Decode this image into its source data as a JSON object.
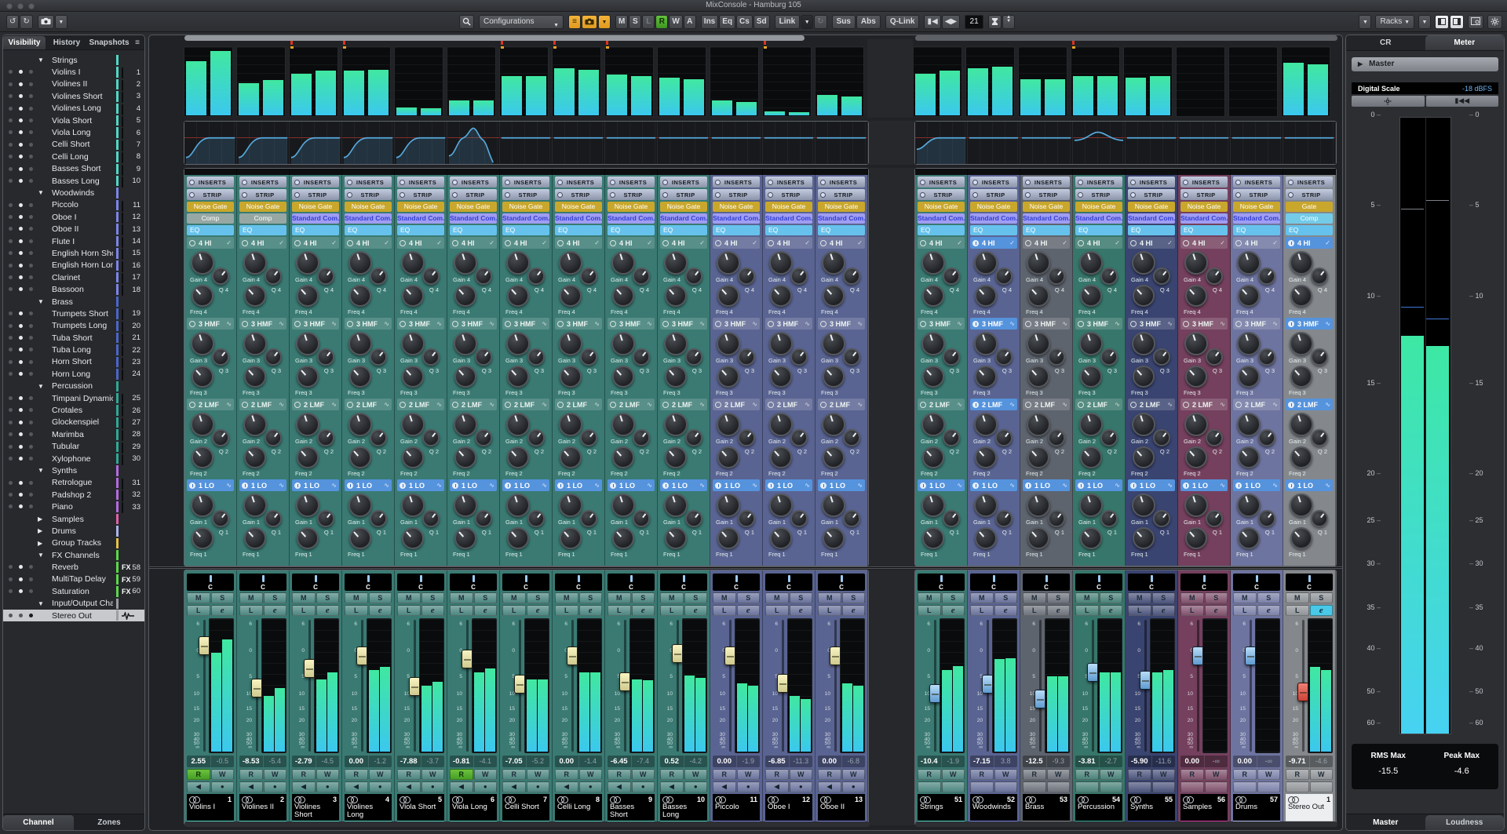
{
  "window": {
    "title": "MixConsole - Hamburg 105"
  },
  "toolbar": {
    "undo": "↺",
    "redo": "↻",
    "configurations": "Configurations",
    "channel_buttons": [
      "M",
      "S",
      "L",
      "R",
      "W",
      "A"
    ],
    "active_channel_button": "R",
    "disabled_channel_button": "L",
    "rack_filter_buttons": [
      "Ins",
      "Eq",
      "Cs",
      "Sd"
    ],
    "link": "Link",
    "sus": "Sus",
    "abs": "Abs",
    "qlink": "Q-Link",
    "width_value": "21",
    "racks": "Racks"
  },
  "sidebar": {
    "tabs": [
      "Visibility",
      "History",
      "Snapshots"
    ],
    "active_tab": "Visibility",
    "menu_icon": "≡",
    "bottom_tabs": [
      "Channel",
      "Zones"
    ],
    "active_bottom_tab": "Channel",
    "groups": [
      {
        "label": "Strings",
        "color": "#52d7c7",
        "collapsed": false,
        "items": [
          {
            "num": "1",
            "name": "Violins I"
          },
          {
            "num": "2",
            "name": "Violines II"
          },
          {
            "num": "3",
            "name": "Violines Short"
          },
          {
            "num": "4",
            "name": "Violines Long"
          },
          {
            "num": "5",
            "name": "Viola Short"
          },
          {
            "num": "6",
            "name": "Viola Long"
          },
          {
            "num": "7",
            "name": "Celli Short"
          },
          {
            "num": "8",
            "name": "Celli Long"
          },
          {
            "num": "9",
            "name": "Basses Short"
          },
          {
            "num": "10",
            "name": "Basses Long"
          }
        ]
      },
      {
        "label": "Woodwinds",
        "color": "#7b85e8",
        "collapsed": false,
        "items": [
          {
            "num": "11",
            "name": "Piccolo"
          },
          {
            "num": "12",
            "name": "Oboe I"
          },
          {
            "num": "13",
            "name": "Oboe II"
          },
          {
            "num": "14",
            "name": "Flute I"
          },
          {
            "num": "15",
            "name": "English Horn Short"
          },
          {
            "num": "16",
            "name": "English Horn Long"
          },
          {
            "num": "17",
            "name": "Clarinet"
          },
          {
            "num": "18",
            "name": "Bassoon"
          }
        ]
      },
      {
        "label": "Brass",
        "color": "#4a66c8",
        "collapsed": false,
        "items": [
          {
            "num": "19",
            "name": "Trumpets Short"
          },
          {
            "num": "20",
            "name": "Trumpets Long"
          },
          {
            "num": "21",
            "name": "Tuba Short"
          },
          {
            "num": "22",
            "name": "Tuba Long"
          },
          {
            "num": "23",
            "name": "Horn Short"
          },
          {
            "num": "24",
            "name": "Horn Long"
          }
        ]
      },
      {
        "label": "Percussion",
        "color": "#2fa896",
        "collapsed": false,
        "items": [
          {
            "num": "25",
            "name": "Timpani Dynamics"
          },
          {
            "num": "26",
            "name": "Crotales"
          },
          {
            "num": "27",
            "name": "Glockenspiel"
          },
          {
            "num": "28",
            "name": "Marimba"
          },
          {
            "num": "29",
            "name": "Tubular"
          },
          {
            "num": "30",
            "name": "Xylophone"
          }
        ]
      },
      {
        "label": "Synths",
        "color": "#b56ae0",
        "collapsed": false,
        "items": [
          {
            "num": "31",
            "name": "Retrologue"
          },
          {
            "num": "32",
            "name": "Padshop 2"
          },
          {
            "num": "33",
            "name": "Piano"
          }
        ]
      },
      {
        "label": "Samples",
        "color": "#e060a8",
        "collapsed": true,
        "items": []
      },
      {
        "label": "Drums",
        "color": "#aab4ea",
        "collapsed": true,
        "items": []
      },
      {
        "label": "Group Tracks",
        "color": "#e8c048",
        "collapsed": true,
        "items": []
      },
      {
        "label": "FX Channels",
        "color": "#5ad848",
        "collapsed": false,
        "items": [
          {
            "num": "58",
            "name": "Reverb",
            "badge": "FX"
          },
          {
            "num": "59",
            "name": "MultiTap Delay",
            "badge": "FX"
          },
          {
            "num": "60",
            "name": "Saturation",
            "badge": "FX"
          }
        ]
      },
      {
        "label": "Input/Output Channels",
        "color": "#9a9da2",
        "collapsed": false,
        "items": [
          {
            "num": "",
            "name": "Stereo Out",
            "badge": "wave",
            "selected": true
          }
        ]
      }
    ]
  },
  "rack": {
    "inserts": "INSERTS",
    "strip": "STRIP",
    "bands": [
      {
        "id": "4 HI",
        "gain": "Gain 4",
        "freq": "Freq 4",
        "q": "Q 4",
        "icon": "✓"
      },
      {
        "id": "3 HMF",
        "gain": "Gain 3",
        "freq": "Freq 3",
        "q": "Q 3",
        "icon": "∿"
      },
      {
        "id": "2 LMF",
        "gain": "Gain 2",
        "freq": "Freq 2",
        "q": "Q 2",
        "icon": "∿"
      },
      {
        "id": "1 LO",
        "gain": "Gain 1",
        "freq": "Freq 1",
        "q": "Q 1",
        "icon": "∿"
      }
    ]
  },
  "strip_labels": {
    "m": "M",
    "s": "S",
    "l": "L",
    "e": "e",
    "r": "R",
    "w": "W",
    "pan": "C",
    "mon": "◀",
    "rec": "●"
  },
  "fader_scale": [
    "6",
    "0",
    "5",
    "10",
    "15",
    "20",
    "30",
    "40",
    "50",
    "∞"
  ],
  "channels": {
    "left": [
      {
        "num": "1",
        "name": "Violins I",
        "value": "2.55",
        "peak": "-0.5",
        "db": 2.55,
        "color": "#52d7c7",
        "tint": "#3A7A73",
        "gate": "Noise Gate",
        "comp": "Comp",
        "comp_style": "cgray",
        "active_bands": [
          "1 LO"
        ],
        "eq": "rise",
        "bridge": [
          0.8,
          0.95
        ],
        "meter": [
          0.75,
          0.85
        ],
        "clip": false,
        "r_on": true,
        "cap": "yellow",
        "group": false
      },
      {
        "num": "2",
        "name": "Violines II",
        "value": "-8.53",
        "peak": "-5.4",
        "db": -8.53,
        "color": "#52d7c7",
        "tint": "#3A7A73",
        "gate": "Noise Gate",
        "comp": "Comp",
        "comp_style": "cgray",
        "active_bands": [
          "1 LO"
        ],
        "eq": "rise",
        "bridge": [
          0.48,
          0.52
        ],
        "meter": [
          0.42,
          0.48
        ],
        "clip": false,
        "r_on": false,
        "cap": "yellow",
        "group": false
      },
      {
        "num": "3",
        "name": "Violines Short",
        "value": "-2.79",
        "peak": "-4.5",
        "db": -2.79,
        "color": "#52d7c7",
        "tint": "#3A7A73",
        "gate": "Noise Gate",
        "comp": "Standard Com...or",
        "comp_style": "cpurple",
        "active_bands": [
          "1 LO"
        ],
        "eq": "rise",
        "bridge": [
          0.62,
          0.66
        ],
        "meter": [
          0.55,
          0.6
        ],
        "clip": true,
        "r_on": false,
        "cap": "yellow",
        "group": false
      },
      {
        "num": "4",
        "name": "Violines Long",
        "value": "0.00",
        "peak": "-1.2",
        "db": 0.0,
        "color": "#52d7c7",
        "tint": "#3A7A73",
        "gate": "Noise Gate",
        "comp": "Standard Com...or",
        "comp_style": "cpurple",
        "active_bands": [
          "1 LO"
        ],
        "eq": "rise",
        "bridge": [
          0.66,
          0.68
        ],
        "meter": [
          0.62,
          0.64
        ],
        "clip": true,
        "r_on": false,
        "cap": "yellow",
        "group": false
      },
      {
        "num": "5",
        "name": "Viola Short",
        "value": "-7.88",
        "peak": "-3.7",
        "db": -7.88,
        "color": "#52d7c7",
        "tint": "#3A7A73",
        "gate": "Noise Gate",
        "comp": "Standard Com...or",
        "comp_style": "cpurple",
        "active_bands": [
          "1 LO"
        ],
        "eq": "rise",
        "bridge": [
          0.12,
          0.1
        ],
        "meter": [
          0.5,
          0.53
        ],
        "clip": false,
        "r_on": false,
        "cap": "yellow",
        "group": false
      },
      {
        "num": "6",
        "name": "Viola Long",
        "value": "-0.81",
        "peak": "-4.1",
        "db": -0.81,
        "color": "#52d7c7",
        "tint": "#3A7A73",
        "gate": "Noise Gate",
        "comp": "Standard Com...or",
        "comp_style": "cpurple",
        "active_bands": [
          "1 LO"
        ],
        "eq": "peakcut",
        "bridge": [
          0.22,
          0.22
        ],
        "meter": [
          0.6,
          0.63
        ],
        "clip": false,
        "r_on": true,
        "cap": "yellow",
        "group": false
      },
      {
        "num": "7",
        "name": "Celli Short",
        "value": "-7.05",
        "peak": "-5.2",
        "db": -7.05,
        "color": "#52d7c7",
        "tint": "#3A7A73",
        "gate": "Noise Gate",
        "comp": "Standard Com...or",
        "comp_style": "cpurple",
        "active_bands": [
          "1 LO"
        ],
        "eq": "flat",
        "bridge": [
          0.58,
          0.58
        ],
        "meter": [
          0.55,
          0.55
        ],
        "clip": true,
        "r_on": false,
        "cap": "yellow",
        "group": false
      },
      {
        "num": "8",
        "name": "Celli Long",
        "value": "0.00",
        "peak": "-1.4",
        "db": 0.0,
        "color": "#52d7c7",
        "tint": "#3A7A73",
        "gate": "Noise Gate",
        "comp": "Standard Com...or",
        "comp_style": "cpurple",
        "active_bands": [
          "1 LO"
        ],
        "eq": "flat",
        "bridge": [
          0.7,
          0.68
        ],
        "meter": [
          0.6,
          0.6
        ],
        "clip": true,
        "r_on": false,
        "cap": "yellow",
        "group": false
      },
      {
        "num": "9",
        "name": "Basses Short",
        "value": "-6.45",
        "peak": "-7.4",
        "db": -6.45,
        "color": "#52d7c7",
        "tint": "#3A7A73",
        "gate": "Noise Gate",
        "comp": "Standard Com...or",
        "comp_style": "cpurple",
        "active_bands": [
          "1 LO"
        ],
        "eq": "flat",
        "bridge": [
          0.6,
          0.58
        ],
        "meter": [
          0.55,
          0.54
        ],
        "clip": true,
        "r_on": false,
        "cap": "yellow",
        "group": false
      },
      {
        "num": "10",
        "name": "Basses Long",
        "value": "0.52",
        "peak": "-4.2",
        "db": 0.52,
        "color": "#52d7c7",
        "tint": "#3A7A73",
        "gate": "Noise Gate",
        "comp": "Standard Com...or",
        "comp_style": "cpurple",
        "active_bands": [
          "1 LO"
        ],
        "eq": "flat",
        "bridge": [
          0.56,
          0.54
        ],
        "meter": [
          0.58,
          0.56
        ],
        "clip": false,
        "r_on": false,
        "cap": "yellow",
        "group": false
      },
      {
        "num": "11",
        "name": "Piccolo",
        "value": "0.00",
        "peak": "-1.9",
        "db": 0.0,
        "color": "#7b85e8",
        "tint": "#5A6492",
        "gate": "Noise Gate",
        "comp": "Standard Com...or",
        "comp_style": "cpurple",
        "active_bands": [
          "1 LO"
        ],
        "eq": "flat",
        "bridge": [
          0.22,
          0.2
        ],
        "meter": [
          0.52,
          0.5
        ],
        "clip": false,
        "r_on": false,
        "cap": "yellow",
        "group": false
      },
      {
        "num": "12",
        "name": "Oboe I",
        "value": "-6.85",
        "peak": "-11.3",
        "db": -6.85,
        "color": "#7b85e8",
        "tint": "#5A6492",
        "gate": "Noise Gate",
        "comp": "Standard Com...or",
        "comp_style": "cpurple",
        "active_bands": [
          "1 LO"
        ],
        "eq": "flat",
        "bridge": [
          0.06,
          0.05
        ],
        "meter": [
          0.42,
          0.4
        ],
        "clip": true,
        "r_on": false,
        "cap": "yellow",
        "group": false
      },
      {
        "num": "13",
        "name": "Oboe II",
        "value": "0.00",
        "peak": "-6.8",
        "db": 0.0,
        "color": "#7b85e8",
        "tint": "#5A6492",
        "gate": "Noise Gate",
        "comp": "Standard Com...or",
        "comp_style": "cpurple",
        "active_bands": [
          "1 LO"
        ],
        "eq": "flat",
        "bridge": [
          0.3,
          0.28
        ],
        "meter": [
          0.52,
          0.5
        ],
        "clip": false,
        "r_on": false,
        "cap": "yellow",
        "group": false
      }
    ],
    "right": [
      {
        "num": "51",
        "name": "Strings",
        "value": "-10.4",
        "peak": "-1.9",
        "db": -10.4,
        "color": "#52d7c7",
        "tint": "#3A7A73",
        "gate": "Noise Gate",
        "comp": "Standard Com...or",
        "comp_style": "cpurple",
        "active_bands": [
          "1 LO"
        ],
        "eq": "risesm",
        "bridge": [
          0.62,
          0.66
        ],
        "meter": [
          0.62,
          0.65
        ],
        "clip": false,
        "r_on": false,
        "cap": "blue",
        "group": true
      },
      {
        "num": "52",
        "name": "Woodwinds",
        "value": "-7.15",
        "peak": "3.8",
        "db": -7.15,
        "color": "#7b85e8",
        "tint": "#5A6492",
        "gate": "Noise Gate",
        "comp": "Standard Com...or",
        "comp_style": "cpurple",
        "active_bands": [
          "4 HI",
          "3 HMF",
          "2 LMF",
          "1 LO"
        ],
        "eq": "flat",
        "bridge": [
          0.7,
          0.72
        ],
        "meter": [
          0.7,
          0.71
        ],
        "clip": false,
        "r_on": false,
        "cap": "blue",
        "group": true
      },
      {
        "num": "53",
        "name": "Brass",
        "value": "-12.5",
        "peak": "-9.3",
        "db": -12.5,
        "color": "#8a8d92",
        "tint": "#5E646E",
        "gate": "Noise Gate",
        "comp": "Standard Com...or",
        "comp_style": "cpurple",
        "active_bands": [
          "1 LO"
        ],
        "eq": "flat",
        "bridge": [
          0.54,
          0.54
        ],
        "meter": [
          0.57,
          0.57
        ],
        "clip": false,
        "r_on": false,
        "cap": "blue",
        "group": true
      },
      {
        "num": "54",
        "name": "Percussion",
        "value": "-3.81",
        "peak": "-2.7",
        "db": -3.81,
        "color": "#2fa896",
        "tint": "#37766B",
        "gate": "Noise Gate",
        "comp": "Standard Com...or",
        "comp_style": "cpurple",
        "active_bands": [
          "1 LO"
        ],
        "eq": "bump",
        "bridge": [
          0.58,
          0.58
        ],
        "meter": [
          0.6,
          0.6
        ],
        "clip": true,
        "r_on": false,
        "cap": "blue",
        "group": true
      },
      {
        "num": "55",
        "name": "Synths",
        "value": "-5.90",
        "peak": "-11.6",
        "db": -5.9,
        "color": "#4858c8",
        "tint": "#3A4470",
        "gate": "Noise Gate",
        "comp": "Standard Com...or",
        "comp_style": "cpurple",
        "active_bands": [
          "1 LO"
        ],
        "eq": "flat",
        "bridge": [
          0.56,
          0.58
        ],
        "meter": [
          0.6,
          0.62
        ],
        "clip": false,
        "r_on": false,
        "cap": "blue",
        "group": true
      },
      {
        "num": "56",
        "name": "Samples",
        "value": "0.00",
        "peak": "-∞",
        "db": 0.0,
        "color": "#d838a0",
        "tint": "#74405E",
        "gate": "Noise Gate",
        "comp": "Standard Com...or",
        "comp_style": "cpurple",
        "active_bands": [
          "1 LO"
        ],
        "eq": "flat",
        "bridge": [
          0,
          0
        ],
        "meter": [
          0,
          0
        ],
        "clip": false,
        "r_on": false,
        "cap": "blue",
        "group": true
      },
      {
        "num": "57",
        "name": "Drums",
        "value": "0.00",
        "peak": "-∞",
        "db": 0.0,
        "color": "#b8c0f0",
        "tint": "#6E74A0",
        "gate": "Noise Gate",
        "comp": "Standard Com...or",
        "comp_style": "cpurple",
        "active_bands": [
          "1 LO"
        ],
        "eq": "flat",
        "bridge": [
          0,
          0
        ],
        "meter": [
          0,
          0
        ],
        "clip": false,
        "r_on": false,
        "cap": "blue",
        "group": true
      },
      {
        "num": "1",
        "name": "Stereo Out",
        "value": "-9.71",
        "peak": "-4.6",
        "db": -9.71,
        "color": "#c4c8cc",
        "tint": "#84888C",
        "gate": "Gate",
        "comp": "Comp",
        "comp_style": "ccyan",
        "active_bands": [
          "4 HI",
          "3 HMF",
          "2 LMF",
          "1 LO"
        ],
        "eq": "flat",
        "bridge": [
          0.78,
          0.76
        ],
        "meter": [
          0.64,
          0.62
        ],
        "clip": false,
        "r_on": false,
        "cap": "red",
        "group": true,
        "e_on": true,
        "selected": true
      }
    ]
  },
  "right_panel": {
    "tabs": [
      "CR",
      "Meter"
    ],
    "active_tab": "Meter",
    "master_select": "Master",
    "digital_scale_label": "Digital Scale",
    "digital_scale_value": "-18 dBFS",
    "meter_scale": [
      "0",
      "5",
      "10",
      "15",
      "20",
      "25",
      "30",
      "35",
      "40",
      "50",
      "60"
    ],
    "master_meter": {
      "left_db": -12.3,
      "right_db": -12.9,
      "left_peak_db": -5.1,
      "right_peak_db": -4.6,
      "left_rms_db": -10.6,
      "right_rms_db": -11.3
    },
    "rms_max_label": "RMS Max",
    "rms_max": "-15.5",
    "peak_max_label": "Peak Max",
    "peak_max": "-4.6",
    "bottom_tabs": [
      "Master",
      "Loudness"
    ],
    "active_bottom_tab": "Master"
  }
}
